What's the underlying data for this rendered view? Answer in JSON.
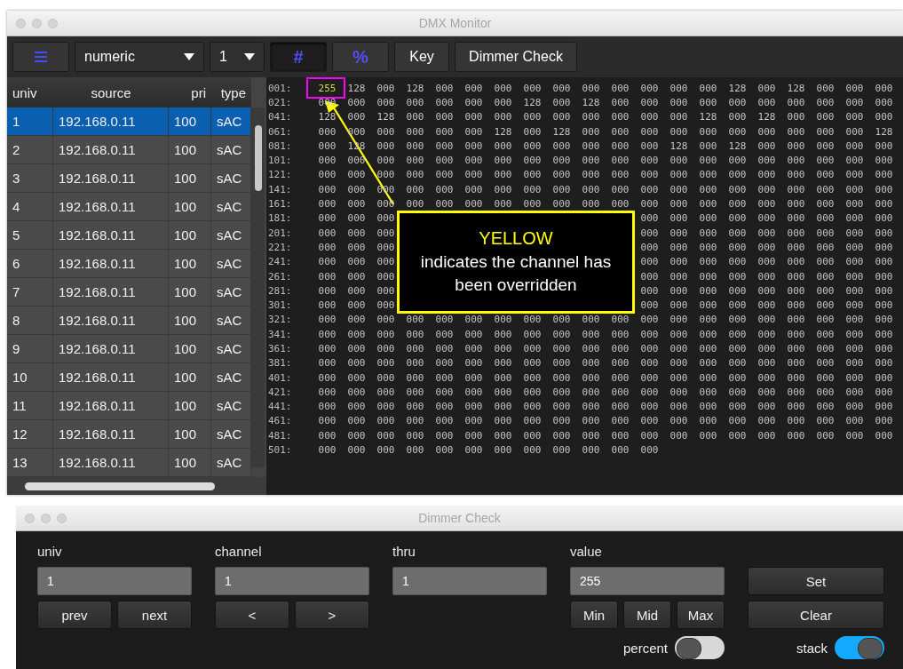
{
  "monitor_window": {
    "title": "DMX Monitor"
  },
  "toolbar": {
    "mode_dropdown": "numeric",
    "universe_dropdown": "1",
    "view_buttons": [
      {
        "label": "#",
        "selected": true
      },
      {
        "label": "%",
        "selected": false
      }
    ],
    "buttons": [
      "Key",
      "Dimmer Check"
    ]
  },
  "table": {
    "columns": [
      "univ",
      "source",
      "pri",
      "type"
    ],
    "rows": [
      {
        "cells": [
          "1",
          "192.168.0.11",
          "100",
          "sAC"
        ],
        "selected": true
      },
      {
        "cells": [
          "2",
          "192.168.0.11",
          "100",
          "sAC"
        ],
        "selected": false
      },
      {
        "cells": [
          "3",
          "192.168.0.11",
          "100",
          "sAC"
        ],
        "selected": false
      },
      {
        "cells": [
          "4",
          "192.168.0.11",
          "100",
          "sAC"
        ],
        "selected": false
      },
      {
        "cells": [
          "5",
          "192.168.0.11",
          "100",
          "sAC"
        ],
        "selected": false
      },
      {
        "cells": [
          "6",
          "192.168.0.11",
          "100",
          "sAC"
        ],
        "selected": false
      },
      {
        "cells": [
          "7",
          "192.168.0.11",
          "100",
          "sAC"
        ],
        "selected": false
      },
      {
        "cells": [
          "8",
          "192.168.0.11",
          "100",
          "sAC"
        ],
        "selected": false
      },
      {
        "cells": [
          "9",
          "192.168.0.11",
          "100",
          "sAC"
        ],
        "selected": false
      },
      {
        "cells": [
          "10",
          "192.168.0.11",
          "100",
          "sAC"
        ],
        "selected": false
      },
      {
        "cells": [
          "11",
          "192.168.0.11",
          "100",
          "sAC"
        ],
        "selected": false
      },
      {
        "cells": [
          "12",
          "192.168.0.11",
          "100",
          "sAC"
        ],
        "selected": false
      },
      {
        "cells": [
          "13",
          "192.168.0.11",
          "100",
          "sAC"
        ],
        "selected": false
      }
    ]
  },
  "grid": {
    "rows": [
      {
        "label": "001:",
        "values": [
          {
            "value": "255",
            "overridden": true
          },
          "128",
          "000",
          "128",
          "000",
          "000",
          "000",
          "000",
          "000",
          "000",
          "000",
          "000",
          "000",
          "000",
          "128",
          "000",
          "128",
          "000",
          "000",
          "000"
        ]
      },
      {
        "label": "021:",
        "values": [
          "000",
          "000",
          "000",
          "000",
          "000",
          "000",
          "000",
          "128",
          "000",
          "128",
          "000",
          "000",
          "000",
          "000",
          "000",
          "000",
          "000",
          "000",
          "000",
          "000"
        ]
      },
      {
        "label": "041:",
        "values": [
          "128",
          "000",
          "128",
          "000",
          "000",
          "000",
          "000",
          "000",
          "000",
          "000",
          "000",
          "000",
          "000",
          "128",
          "000",
          "128",
          "000",
          "000",
          "000",
          "000"
        ]
      },
      {
        "label": "061:",
        "values": [
          "000",
          "000",
          "000",
          "000",
          "000",
          "000",
          "128",
          "000",
          "128",
          "000",
          "000",
          "000",
          "000",
          "000",
          "000",
          "000",
          "000",
          "000",
          "000",
          "128"
        ]
      },
      {
        "label": "081:",
        "values": [
          "000",
          "128",
          "000",
          "000",
          "000",
          "000",
          "000",
          "000",
          "000",
          "000",
          "000",
          "000",
          "128",
          "000",
          "128",
          "000",
          "000",
          "000",
          "000",
          "000"
        ]
      },
      {
        "label": "101:",
        "values": [
          "000",
          "000",
          "000",
          "000",
          "000",
          "000",
          "000",
          "000",
          "000",
          "000",
          "000",
          "000",
          "000",
          "000",
          "000",
          "000",
          "000",
          "000",
          "000",
          "000"
        ]
      },
      {
        "label": "121:",
        "values": [
          "000",
          "000",
          "000",
          "000",
          "000",
          "000",
          "000",
          "000",
          "000",
          "000",
          "000",
          "000",
          "000",
          "000",
          "000",
          "000",
          "000",
          "000",
          "000",
          "000"
        ]
      },
      {
        "label": "141:",
        "values": [
          "000",
          "000",
          "000",
          "000",
          "000",
          "000",
          "000",
          "000",
          "000",
          "000",
          "000",
          "000",
          "000",
          "000",
          "000",
          "000",
          "000",
          "000",
          "000",
          "000"
        ]
      },
      {
        "label": "161:",
        "values": [
          "000",
          "000",
          "000",
          "000",
          "000",
          "000",
          "000",
          "000",
          "000",
          "000",
          "000",
          "000",
          "000",
          "000",
          "000",
          "000",
          "000",
          "000",
          "000",
          "000"
        ]
      },
      {
        "label": "181:",
        "values": [
          "000",
          "000",
          "000"
        ],
        "values_right_of_callout": [
          "000",
          "000",
          "000",
          "000",
          "000",
          "000",
          "000",
          "000",
          "000"
        ]
      },
      {
        "label": "201:",
        "values": [
          "000",
          "000",
          "000"
        ],
        "values_right_of_callout": [
          "000",
          "000",
          "000",
          "000",
          "000",
          "000",
          "000",
          "000",
          "000"
        ]
      },
      {
        "label": "221:",
        "values": [
          "000",
          "000",
          "000"
        ],
        "values_right_of_callout": [
          "000",
          "000",
          "000",
          "000",
          "000",
          "000",
          "000",
          "000",
          "000"
        ]
      },
      {
        "label": "241:",
        "values": [
          "000",
          "000",
          "000"
        ],
        "values_right_of_callout": [
          "000",
          "000",
          "000",
          "000",
          "000",
          "000",
          "000",
          "000",
          "000"
        ]
      },
      {
        "label": "261:",
        "values": [
          "000",
          "000",
          "000"
        ],
        "values_right_of_callout": [
          "000",
          "000",
          "000",
          "000",
          "000",
          "000",
          "000",
          "000",
          "000"
        ]
      },
      {
        "label": "281:",
        "values": [
          "000",
          "000",
          "000"
        ],
        "values_right_of_callout": [
          "000",
          "000",
          "000",
          "000",
          "000",
          "000",
          "000",
          "000",
          "000"
        ]
      },
      {
        "label": "301:",
        "values": [
          "000",
          "000",
          "000"
        ],
        "values_right_of_callout": [
          "000",
          "000",
          "000",
          "000",
          "000",
          "000",
          "000",
          "000",
          "000"
        ]
      },
      {
        "label": "321:",
        "values": [
          "000",
          "000",
          "000",
          "000",
          "000",
          "000",
          "000",
          "000",
          "000",
          "000",
          "000",
          "000",
          "000",
          "000",
          "000",
          "000",
          "000",
          "000",
          "000",
          "000"
        ]
      },
      {
        "label": "341:",
        "values": [
          "000",
          "000",
          "000",
          "000",
          "000",
          "000",
          "000",
          "000",
          "000",
          "000",
          "000",
          "000",
          "000",
          "000",
          "000",
          "000",
          "000",
          "000",
          "000",
          "000"
        ]
      },
      {
        "label": "361:",
        "values": [
          "000",
          "000",
          "000",
          "000",
          "000",
          "000",
          "000",
          "000",
          "000",
          "000",
          "000",
          "000",
          "000",
          "000",
          "000",
          "000",
          "000",
          "000",
          "000",
          "000"
        ]
      },
      {
        "label": "381:",
        "values": [
          "000",
          "000",
          "000",
          "000",
          "000",
          "000",
          "000",
          "000",
          "000",
          "000",
          "000",
          "000",
          "000",
          "000",
          "000",
          "000",
          "000",
          "000",
          "000",
          "000"
        ]
      },
      {
        "label": "401:",
        "values": [
          "000",
          "000",
          "000",
          "000",
          "000",
          "000",
          "000",
          "000",
          "000",
          "000",
          "000",
          "000",
          "000",
          "000",
          "000",
          "000",
          "000",
          "000",
          "000",
          "000"
        ]
      },
      {
        "label": "421:",
        "values": [
          "000",
          "000",
          "000",
          "000",
          "000",
          "000",
          "000",
          "000",
          "000",
          "000",
          "000",
          "000",
          "000",
          "000",
          "000",
          "000",
          "000",
          "000",
          "000",
          "000"
        ]
      },
      {
        "label": "441:",
        "values": [
          "000",
          "000",
          "000",
          "000",
          "000",
          "000",
          "000",
          "000",
          "000",
          "000",
          "000",
          "000",
          "000",
          "000",
          "000",
          "000",
          "000",
          "000",
          "000",
          "000"
        ]
      },
      {
        "label": "461:",
        "values": [
          "000",
          "000",
          "000",
          "000",
          "000",
          "000",
          "000",
          "000",
          "000",
          "000",
          "000",
          "000",
          "000",
          "000",
          "000",
          "000",
          "000",
          "000",
          "000",
          "000"
        ]
      },
      {
        "label": "481:",
        "values": [
          "000",
          "000",
          "000",
          "000",
          "000",
          "000",
          "000",
          "000",
          "000",
          "000",
          "000",
          "000",
          "000",
          "000",
          "000",
          "000",
          "000",
          "000",
          "000",
          "000"
        ]
      },
      {
        "label": "501:",
        "values": [
          "000",
          "000",
          "000",
          "000",
          "000",
          "000",
          "000",
          "000",
          "000",
          "000",
          "000",
          "000"
        ]
      }
    ]
  },
  "callout": {
    "title": "YELLOW",
    "text": "indicates the channel has been overridden"
  },
  "dimmer_window": {
    "title": "Dimmer Check",
    "fields": [
      {
        "label": "univ",
        "value": "1",
        "buttons": [
          "prev",
          "next"
        ]
      },
      {
        "label": "channel",
        "value": "1",
        "buttons": [
          "<",
          ">"
        ]
      },
      {
        "label": "thru",
        "value": "1"
      },
      {
        "label": "value",
        "value": "255",
        "buttons": [
          "Min",
          "Mid",
          "Max"
        ]
      }
    ],
    "percent_toggle": {
      "label": "percent",
      "on": false
    },
    "actions": [
      "Set",
      "Clear"
    ],
    "stack_toggle": {
      "label": "stack",
      "on": true
    }
  }
}
